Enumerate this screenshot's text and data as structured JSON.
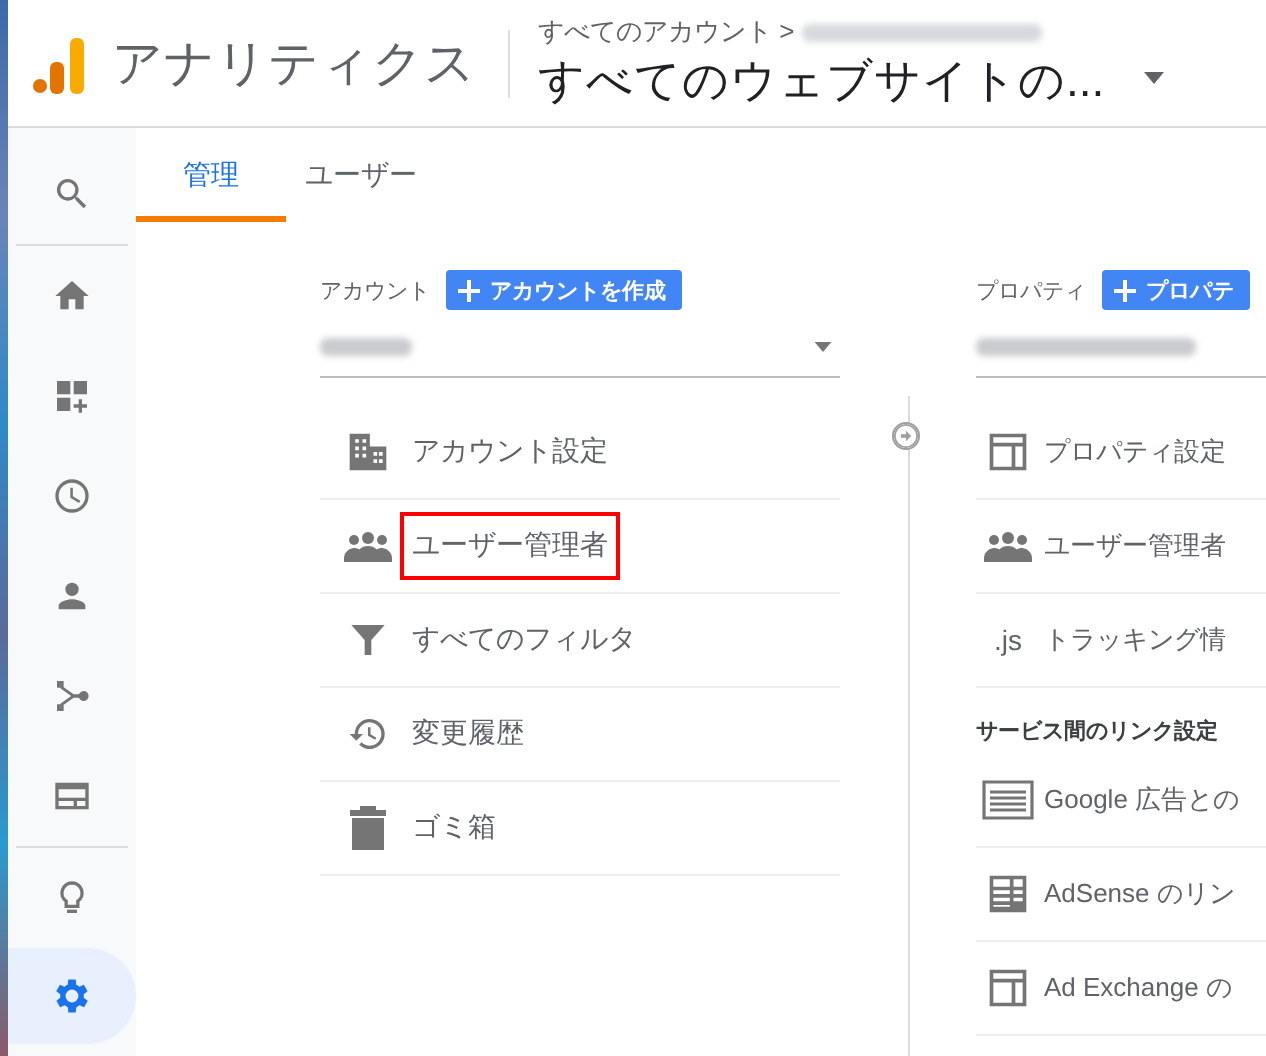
{
  "header": {
    "app_name": "アナリティクス",
    "breadcrumb": "すべてのアカウント >",
    "view_title": "すべてのウェブサイトの..."
  },
  "sidebar": [
    {
      "selected": false
    },
    {
      "selected": false
    },
    {
      "selected": false
    },
    {
      "selected": false
    },
    {
      "selected": false
    },
    {
      "selected": false
    },
    {
      "selected": false
    },
    {
      "selected": false
    },
    {
      "selected": true
    }
  ],
  "tabs": [
    {
      "label": "管理",
      "selected": true
    },
    {
      "label": "ユーザー",
      "selected": false
    }
  ],
  "account_column": {
    "label": "アカウント",
    "button": "アカウントを作成",
    "items": [
      {
        "label": "アカウント設定",
        "highlighted": false
      },
      {
        "label": "ユーザー管理者",
        "highlighted": true
      },
      {
        "label": "すべてのフィルタ",
        "highlighted": false
      },
      {
        "label": "変更履歴",
        "highlighted": false
      },
      {
        "label": "ゴミ箱",
        "highlighted": false
      }
    ]
  },
  "property_column": {
    "label": "プロパティ",
    "button": "プロパテ",
    "items": [
      {
        "kind": "item",
        "label": "プロパティ設定"
      },
      {
        "kind": "item",
        "label": "ユーザー管理者"
      },
      {
        "kind": "item",
        "label": "トラッキング情",
        "icon_text": ".js"
      },
      {
        "kind": "section",
        "label": "サービス間のリンク設定"
      },
      {
        "kind": "item",
        "label": "Google 広告との"
      },
      {
        "kind": "item",
        "label": "AdSense のリン"
      },
      {
        "kind": "item",
        "label": "Ad Exchange の"
      }
    ]
  }
}
